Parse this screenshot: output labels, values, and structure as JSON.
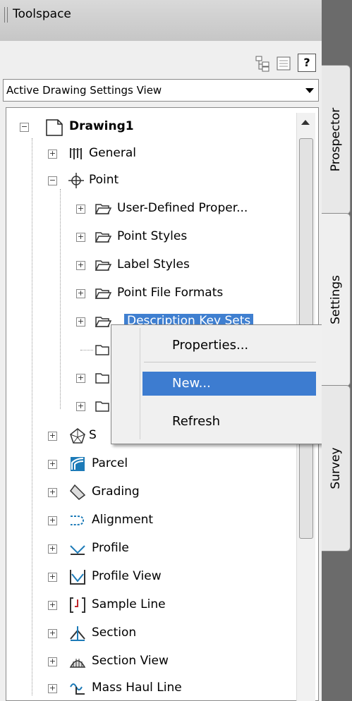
{
  "window": {
    "title": "Toolspace"
  },
  "toolbar": {
    "help_label": "?"
  },
  "view_selector": {
    "selected": "Active Drawing Settings View"
  },
  "tabs": [
    {
      "label": "Prospector"
    },
    {
      "label": "Settings"
    },
    {
      "label": "Survey"
    }
  ],
  "tree": {
    "root": "Drawing1",
    "general": "General",
    "point": "Point",
    "point_children": [
      "User-Defined Proper...",
      "Point Styles",
      "Label Styles",
      "Point File Formats",
      "Description Key Sets"
    ],
    "items": [
      "Parcel",
      "Grading",
      "Alignment",
      "Profile",
      "Profile View",
      "Sample Line",
      "Section",
      "Section View",
      "Mass Haul Line"
    ]
  },
  "context_menu": {
    "properties": "Properties...",
    "new": "New...",
    "refresh": "Refresh"
  },
  "colors": {
    "selection": "#3d7cd0"
  }
}
